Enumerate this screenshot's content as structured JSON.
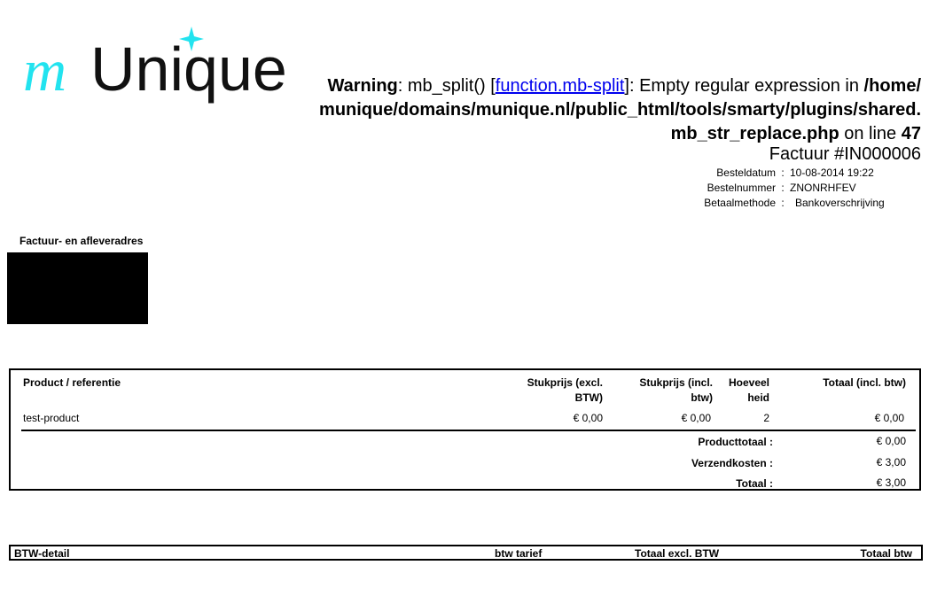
{
  "logo": {
    "prefix": "m",
    "name": "Unique"
  },
  "warning": {
    "label": "Warning",
    "text1": ": mb_split() [",
    "link": "function.mb-split",
    "text2": "]: Empty regular expression in ",
    "path": "/home/munique/domains/munique.nl/public_html/tools/smarty/plugins/shared.mb_str_replace.php",
    "text3": " on line ",
    "line": "47"
  },
  "invoice": {
    "title": "Factuur #IN000006",
    "meta": [
      {
        "label": "Besteldatum",
        "sep": ":",
        "value": "10-08-2014 19:22"
      },
      {
        "label": "Bestelnummer",
        "sep": ":",
        "value": "ZNONRHFEV"
      },
      {
        "label": "Betaalmethode",
        "sep": ":",
        "value": "Bankoverschrijving"
      }
    ]
  },
  "address": {
    "title": "Factuur- en afleveradres"
  },
  "order": {
    "headers": {
      "product": "Product / referentie",
      "unit_excl": "Stukprijs (excl. BTW)",
      "unit_incl": "Stukprijs (incl. btw)",
      "qty": "Hoeveelheid",
      "total": "Totaal (incl. btw)"
    },
    "rows": [
      {
        "product": "test-product",
        "unit_excl": "€ 0,00",
        "unit_incl": "€ 0,00",
        "qty": "2",
        "total": "€ 0,00"
      }
    ],
    "totals": [
      {
        "label": "Producttotaal :",
        "value": "€ 0,00"
      },
      {
        "label": "Verzendkosten :",
        "value": "€ 3,00"
      },
      {
        "label": "Totaal :",
        "value": "€ 3,00"
      }
    ]
  },
  "btw": {
    "headers": {
      "detail": "BTW-detail",
      "rate": "btw tarief",
      "total_excl": "Totaal excl. BTW",
      "total_btw": "Totaal btw"
    }
  },
  "colors": {
    "logo_accent": "#22e3ef",
    "logo_text": "#111111",
    "link": "#0000ee"
  }
}
